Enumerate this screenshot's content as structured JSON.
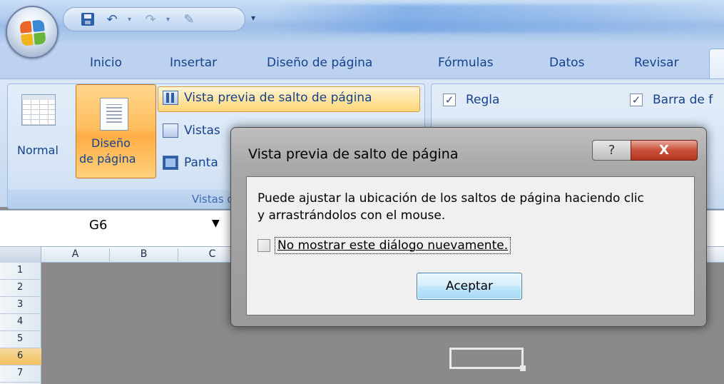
{
  "quick_access": {
    "icons": [
      "save-icon",
      "undo-icon",
      "redo-icon",
      "custom-icon",
      "customize-qat-icon"
    ]
  },
  "tabs": [
    {
      "label": "Inicio"
    },
    {
      "label": "Insertar"
    },
    {
      "label": "Diseño de página"
    },
    {
      "label": "Fórmulas"
    },
    {
      "label": "Datos"
    },
    {
      "label": "Revisar"
    }
  ],
  "ribbon": {
    "views_group": {
      "label": "Vistas de",
      "normal_label": "Normal",
      "page_layout_label_1": "Diseño",
      "page_layout_label_2": "de página",
      "page_break_label": "Vista previa de salto de página",
      "custom_views_label": "Vistas",
      "full_screen_label": "Panta"
    },
    "show_group": {
      "ruler_label": "Regla",
      "ruler_checked": true,
      "formula_bar_label": "Barra de f",
      "formula_bar_checked": true
    }
  },
  "formula_bar": {
    "name_box_value": "G6",
    "dropdown_glyph": "▼"
  },
  "grid": {
    "columns": [
      "A",
      "B",
      "C"
    ],
    "rows": [
      "1",
      "2",
      "3",
      "4",
      "5",
      "6",
      "7"
    ],
    "selected_row": "6"
  },
  "dialog": {
    "title": "Vista previa de salto de página",
    "help_glyph": "?",
    "close_glyph": "X",
    "message_line_1": "Puede ajustar la ubicación de los saltos de página haciendo clic",
    "message_line_2": "y arrastrándolos con el mouse.",
    "checkbox_label": "No mostrar este diálogo nuevamente.",
    "checkbox_checked": false,
    "ok_label": "Aceptar"
  },
  "colors": {
    "ribbon_text": "#15428b",
    "active_button": "#ffbf5f",
    "close_button": "#c9503a",
    "grid_background": "#8a8a8a"
  }
}
